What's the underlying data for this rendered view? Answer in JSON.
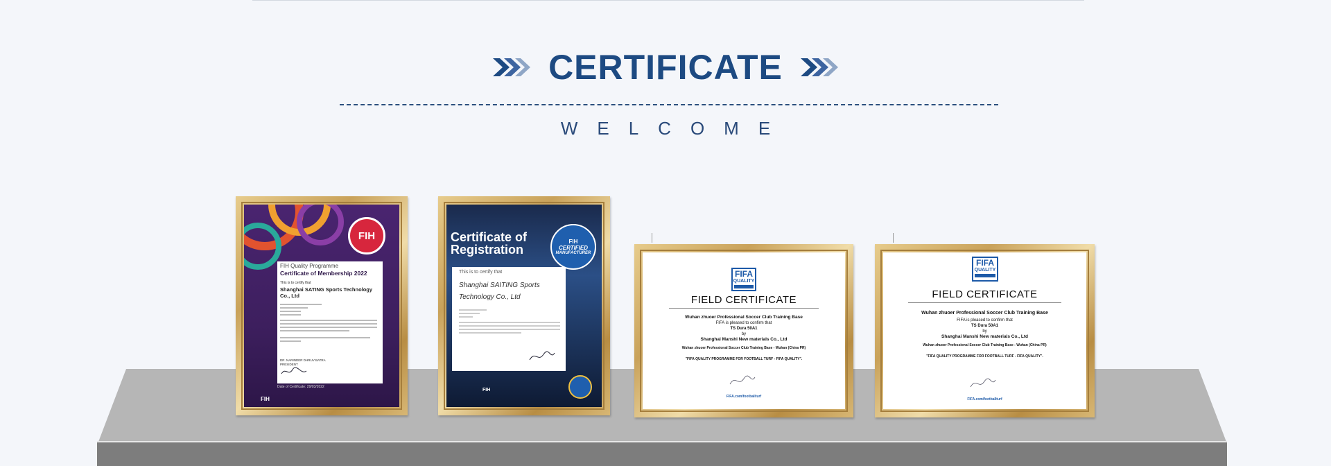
{
  "header": {
    "title": "CERTIFICATE",
    "subtitle": "WELCOME"
  },
  "certificates": [
    {
      "programme": "FIH Quality Programme",
      "heading": "Certificate of Membership 2022",
      "certify": "This is to certify that",
      "company": "Shanghai SATING Sports Technology Co., Ltd",
      "signatory": "DR. NARINDER DHRUV BATRA",
      "role": "PRESIDENT",
      "date": "Date of Certificate: 29/03/2022",
      "badge": "FIH",
      "footer": "FIH"
    },
    {
      "heading": "Certificate of Registration",
      "badge_line1": "CERTIFIED",
      "badge_line2": "MANUFACTURER",
      "certify": "This is to certify that",
      "company": "Shanghai SAITING Sports Technology Co., Ltd",
      "logo": "FIH",
      "footer": "FIH"
    },
    {
      "logo_line1": "FIFA",
      "logo_line2": "QUALITY",
      "title": "FIELD CERTIFICATE",
      "club": "Wuhan zhuoer Professional Soccer Club Training Base",
      "confirm": "FIFA is pleased to confirm that",
      "field_name": "TS Dura 50A1",
      "by": "by",
      "company": "Shanghai Manshi New materials Co., Ltd",
      "location": "Wuhan zhuoer Professional Soccer Club Training Base - Wuhan (China PR)",
      "programme": "\"FIFA QUALITY PROGRAMME FOR FOOTBALL TURF - FIFA QUALITY\".",
      "site": "FIFA.com/footballturf"
    },
    {
      "logo_line1": "FIFA",
      "logo_line2": "QUALITY",
      "title": "FIELD CERTIFICATE",
      "club": "Wuhan zhuoer Professional Soccer Club Training Base",
      "confirm": "FIFA is pleased to confirm that",
      "field_name": "TS Dura 50A1",
      "by": "by",
      "company": "Shanghai Manshi New materials Co., Ltd",
      "location": "Wuhan zhuoer Professional Soccer Club Training Base - Wuhan (China PR)",
      "programme": "\"FIFA QUALITY PROGRAMME FOR FOOTBALL TURF - FIFA QUALITY\".",
      "site": "FIFA.com/footballturf"
    }
  ],
  "colors": {
    "title": "#1d4a82",
    "chevron_dark": "#1d4a82",
    "chevron_light": "#8fa6c6",
    "shelf": "#b6b6b6",
    "shelf_front": "#7d7d7d"
  }
}
